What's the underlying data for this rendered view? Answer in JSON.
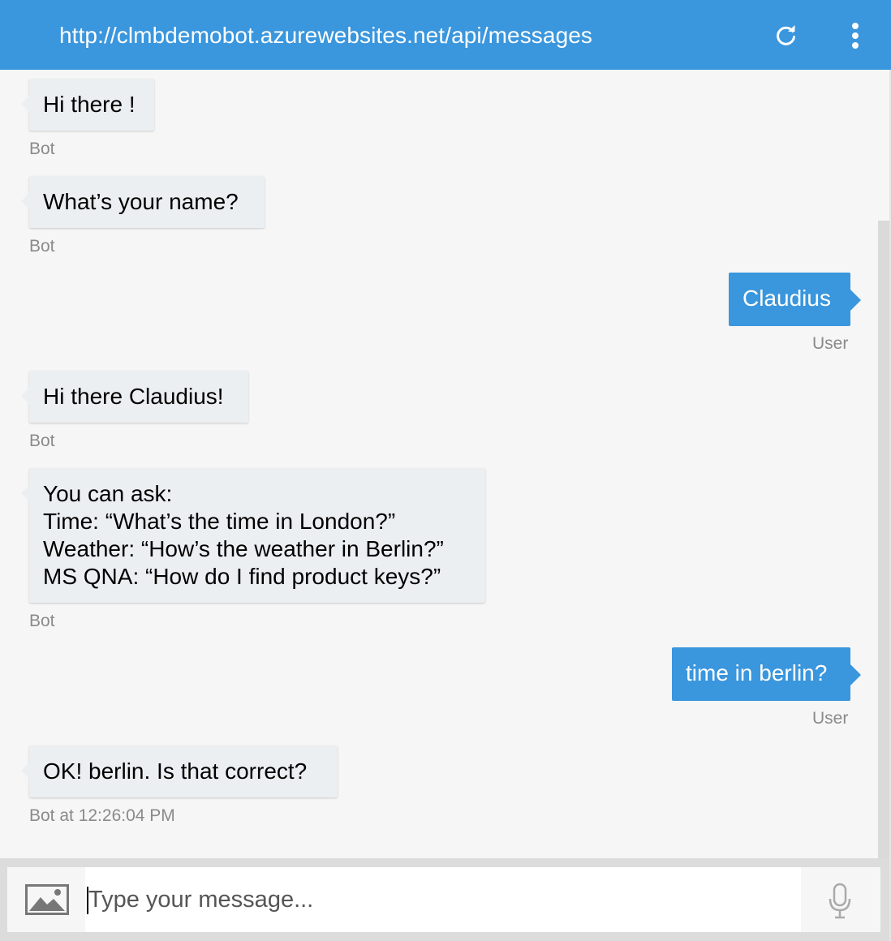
{
  "header": {
    "title": "http://clmbdemobot.azurewebsites.net/api/messages",
    "refresh_icon": "refresh-icon",
    "menu_icon": "more-vertical-icon"
  },
  "messages": [
    {
      "from": "bot",
      "text": "Hi there !",
      "sender": "Bot"
    },
    {
      "from": "bot",
      "text": "What’s your name?",
      "sender": "Bot"
    },
    {
      "from": "user",
      "text": "Claudius",
      "sender": "User"
    },
    {
      "from": "bot",
      "text": "Hi there Claudius!",
      "sender": "Bot"
    },
    {
      "from": "bot",
      "text": "You can ask:\nTime: “What’s the time in London?”\nWeather: “How’s the weather in Berlin?”\nMS QNA: “How do I find product keys?”",
      "sender": "Bot"
    },
    {
      "from": "user",
      "text": "time in berlin?",
      "sender": "User"
    },
    {
      "from": "bot",
      "text": "OK! berlin. Is that correct?",
      "sender": "Bot at 12:26:04 PM"
    }
  ],
  "composer": {
    "placeholder": "Type your message...",
    "value": "",
    "image_icon": "image-upload-icon",
    "mic_icon": "microphone-icon"
  },
  "colors": {
    "accent": "#3a96dd",
    "bot_bubble": "#eceff1",
    "background": "#f6f6f6"
  }
}
